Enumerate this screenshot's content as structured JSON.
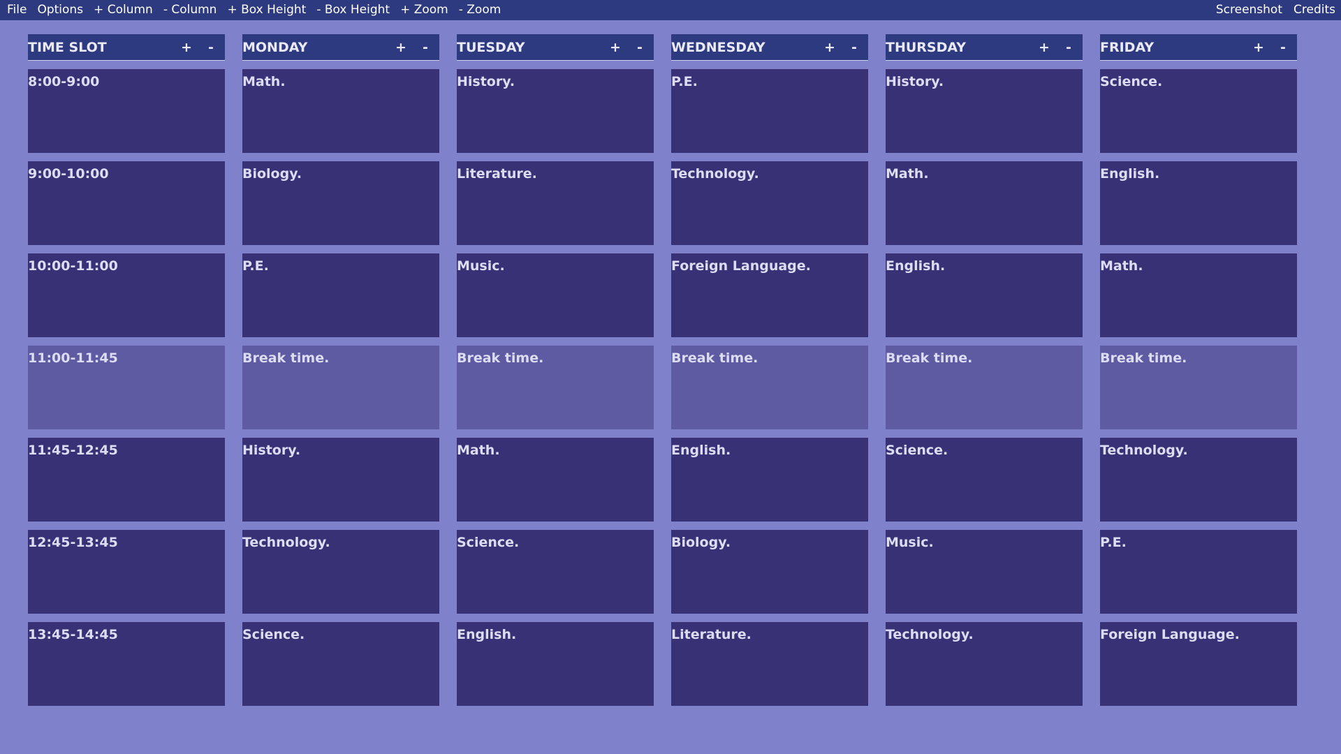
{
  "menu": {
    "left": [
      "File",
      "Options",
      "+ Column",
      "- Column",
      "+ Box Height",
      "- Box Height",
      "+ Zoom",
      "- Zoom"
    ],
    "right": [
      "Screenshot",
      "Credits"
    ]
  },
  "header_controls": {
    "plus": "+",
    "minus": "-"
  },
  "columns": [
    {
      "title": "TIME SLOT",
      "cells": [
        "8:00-9:00",
        "9:00-10:00",
        "10:00-11:00",
        "11:00-11:45",
        "11:45-12:45",
        "12:45-13:45",
        "13:45-14:45"
      ]
    },
    {
      "title": "MONDAY",
      "cells": [
        "Math.",
        "Biology.",
        "P.E.",
        "Break time.",
        "History.",
        "Technology.",
        "Science."
      ]
    },
    {
      "title": "TUESDAY",
      "cells": [
        "History.",
        "Literature.",
        "Music.",
        "Break time.",
        "Math.",
        "Science.",
        "English."
      ]
    },
    {
      "title": "WEDNESDAY",
      "cells": [
        "P.E.",
        "Technology.",
        "Foreign Language.",
        "Break time.",
        "English.",
        "Biology.",
        "Literature."
      ]
    },
    {
      "title": "THURSDAY",
      "cells": [
        "History.",
        "Math.",
        "English.",
        "Break time.",
        "Science.",
        "Music.",
        "Technology."
      ]
    },
    {
      "title": "FRIDAY",
      "cells": [
        "Science.",
        "English.",
        "Math.",
        "Break time.",
        "Technology.",
        "P.E.",
        "Foreign Language."
      ]
    }
  ],
  "colors": {
    "background": "#7f82cb",
    "menubar": "#2e3a7f",
    "header": "#2e3a7f",
    "cell": "#393175",
    "break_cell": "#5f5ba3"
  }
}
